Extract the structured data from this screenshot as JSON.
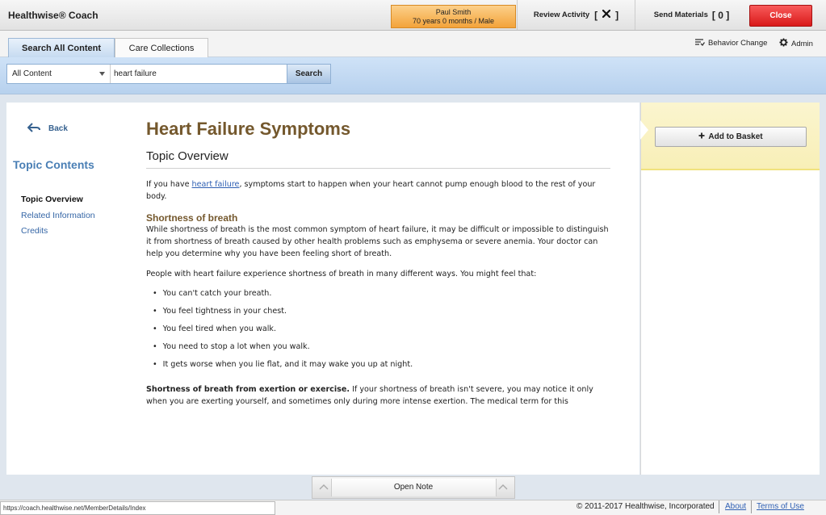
{
  "header": {
    "app_title": "Healthwise® Coach",
    "patient_name": "Paul Smith",
    "patient_info": "70 years 0 months / Male",
    "review_label": "Review Activity",
    "review_bracket_open": "[",
    "review_bracket_close": "]",
    "send_label": "Send Materials",
    "send_count": "[ 0 ]",
    "close_label": "Close"
  },
  "tabs": [
    {
      "label": "Search All Content",
      "active": true
    },
    {
      "label": "Care Collections",
      "active": false
    }
  ],
  "toplinks": {
    "behavior_change": "Behavior Change",
    "admin": "Admin"
  },
  "search": {
    "scope_value": "All Content",
    "query_value": "heart failure",
    "button_label": "Search"
  },
  "sidebar": {
    "back_label": "Back",
    "toc_title": "Topic Contents",
    "items": [
      {
        "label": "Topic Overview",
        "current": true
      },
      {
        "label": "Related Information",
        "current": false
      },
      {
        "label": "Credits",
        "current": false
      }
    ]
  },
  "article": {
    "title": "Heart Failure Symptoms",
    "section_title": "Topic Overview",
    "intro_pre": "If you have ",
    "intro_link": "heart failure",
    "intro_post": ", symptoms start to happen when your heart cannot pump enough blood to the rest of your body.",
    "subheading": "Shortness of breath",
    "para1": "While shortness of breath is the most common symptom of heart failure, it may be difficult or impossible to distinguish it from shortness of breath caused by other health problems such as emphysema or severe anemia. Your doctor can help you determine why you have been feeling short of breath.",
    "para2": "People with heart failure experience shortness of breath in many different ways. You might feel that:",
    "bullets": [
      "You can't catch your breath.",
      "You feel tightness in your chest.",
      "You feel tired when you walk.",
      "You need to stop a lot when you walk.",
      "It gets worse when you lie flat, and it may wake you up at night."
    ],
    "para3_bold": "Shortness of breath from exertion or exercise.",
    "para3": " If your shortness of breath isn't severe, you may notice it only when you are exerting yourself, and sometimes only during more intense exertion. The medical term for this"
  },
  "right_panel": {
    "add_basket_label": "Add to Basket"
  },
  "bottom": {
    "open_note": "Open Note",
    "status_url": "https://coach.healthwise.net/MemberDetails/Index",
    "copyright": "© 2011-2017 Healthwise, Incorporated",
    "about": "About",
    "terms": "Terms of Use"
  }
}
